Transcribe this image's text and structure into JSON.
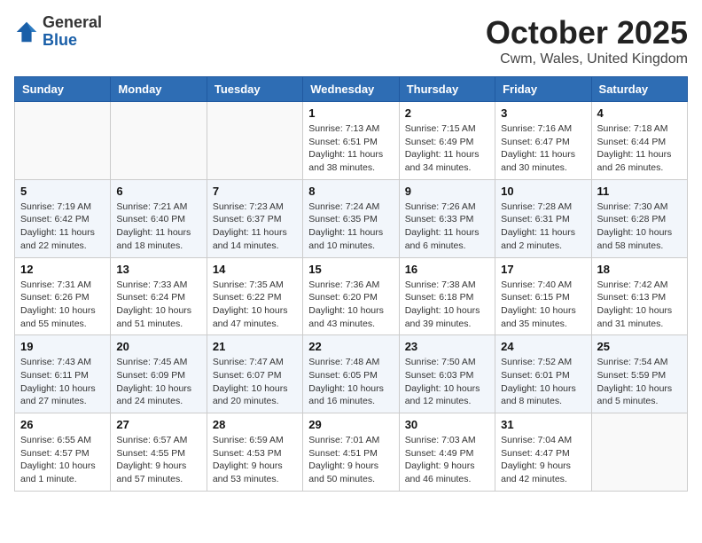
{
  "header": {
    "logo_line1": "General",
    "logo_line2": "Blue",
    "month_title": "October 2025",
    "location": "Cwm, Wales, United Kingdom"
  },
  "days_of_week": [
    "Sunday",
    "Monday",
    "Tuesday",
    "Wednesday",
    "Thursday",
    "Friday",
    "Saturday"
  ],
  "weeks": [
    [
      {
        "day": "",
        "info": ""
      },
      {
        "day": "",
        "info": ""
      },
      {
        "day": "",
        "info": ""
      },
      {
        "day": "1",
        "info": "Sunrise: 7:13 AM\nSunset: 6:51 PM\nDaylight: 11 hours\nand 38 minutes."
      },
      {
        "day": "2",
        "info": "Sunrise: 7:15 AM\nSunset: 6:49 PM\nDaylight: 11 hours\nand 34 minutes."
      },
      {
        "day": "3",
        "info": "Sunrise: 7:16 AM\nSunset: 6:47 PM\nDaylight: 11 hours\nand 30 minutes."
      },
      {
        "day": "4",
        "info": "Sunrise: 7:18 AM\nSunset: 6:44 PM\nDaylight: 11 hours\nand 26 minutes."
      }
    ],
    [
      {
        "day": "5",
        "info": "Sunrise: 7:19 AM\nSunset: 6:42 PM\nDaylight: 11 hours\nand 22 minutes."
      },
      {
        "day": "6",
        "info": "Sunrise: 7:21 AM\nSunset: 6:40 PM\nDaylight: 11 hours\nand 18 minutes."
      },
      {
        "day": "7",
        "info": "Sunrise: 7:23 AM\nSunset: 6:37 PM\nDaylight: 11 hours\nand 14 minutes."
      },
      {
        "day": "8",
        "info": "Sunrise: 7:24 AM\nSunset: 6:35 PM\nDaylight: 11 hours\nand 10 minutes."
      },
      {
        "day": "9",
        "info": "Sunrise: 7:26 AM\nSunset: 6:33 PM\nDaylight: 11 hours\nand 6 minutes."
      },
      {
        "day": "10",
        "info": "Sunrise: 7:28 AM\nSunset: 6:31 PM\nDaylight: 11 hours\nand 2 minutes."
      },
      {
        "day": "11",
        "info": "Sunrise: 7:30 AM\nSunset: 6:28 PM\nDaylight: 10 hours\nand 58 minutes."
      }
    ],
    [
      {
        "day": "12",
        "info": "Sunrise: 7:31 AM\nSunset: 6:26 PM\nDaylight: 10 hours\nand 55 minutes."
      },
      {
        "day": "13",
        "info": "Sunrise: 7:33 AM\nSunset: 6:24 PM\nDaylight: 10 hours\nand 51 minutes."
      },
      {
        "day": "14",
        "info": "Sunrise: 7:35 AM\nSunset: 6:22 PM\nDaylight: 10 hours\nand 47 minutes."
      },
      {
        "day": "15",
        "info": "Sunrise: 7:36 AM\nSunset: 6:20 PM\nDaylight: 10 hours\nand 43 minutes."
      },
      {
        "day": "16",
        "info": "Sunrise: 7:38 AM\nSunset: 6:18 PM\nDaylight: 10 hours\nand 39 minutes."
      },
      {
        "day": "17",
        "info": "Sunrise: 7:40 AM\nSunset: 6:15 PM\nDaylight: 10 hours\nand 35 minutes."
      },
      {
        "day": "18",
        "info": "Sunrise: 7:42 AM\nSunset: 6:13 PM\nDaylight: 10 hours\nand 31 minutes."
      }
    ],
    [
      {
        "day": "19",
        "info": "Sunrise: 7:43 AM\nSunset: 6:11 PM\nDaylight: 10 hours\nand 27 minutes."
      },
      {
        "day": "20",
        "info": "Sunrise: 7:45 AM\nSunset: 6:09 PM\nDaylight: 10 hours\nand 24 minutes."
      },
      {
        "day": "21",
        "info": "Sunrise: 7:47 AM\nSunset: 6:07 PM\nDaylight: 10 hours\nand 20 minutes."
      },
      {
        "day": "22",
        "info": "Sunrise: 7:48 AM\nSunset: 6:05 PM\nDaylight: 10 hours\nand 16 minutes."
      },
      {
        "day": "23",
        "info": "Sunrise: 7:50 AM\nSunset: 6:03 PM\nDaylight: 10 hours\nand 12 minutes."
      },
      {
        "day": "24",
        "info": "Sunrise: 7:52 AM\nSunset: 6:01 PM\nDaylight: 10 hours\nand 8 minutes."
      },
      {
        "day": "25",
        "info": "Sunrise: 7:54 AM\nSunset: 5:59 PM\nDaylight: 10 hours\nand 5 minutes."
      }
    ],
    [
      {
        "day": "26",
        "info": "Sunrise: 6:55 AM\nSunset: 4:57 PM\nDaylight: 10 hours\nand 1 minute."
      },
      {
        "day": "27",
        "info": "Sunrise: 6:57 AM\nSunset: 4:55 PM\nDaylight: 9 hours\nand 57 minutes."
      },
      {
        "day": "28",
        "info": "Sunrise: 6:59 AM\nSunset: 4:53 PM\nDaylight: 9 hours\nand 53 minutes."
      },
      {
        "day": "29",
        "info": "Sunrise: 7:01 AM\nSunset: 4:51 PM\nDaylight: 9 hours\nand 50 minutes."
      },
      {
        "day": "30",
        "info": "Sunrise: 7:03 AM\nSunset: 4:49 PM\nDaylight: 9 hours\nand 46 minutes."
      },
      {
        "day": "31",
        "info": "Sunrise: 7:04 AM\nSunset: 4:47 PM\nDaylight: 9 hours\nand 42 minutes."
      },
      {
        "day": "",
        "info": ""
      }
    ]
  ]
}
